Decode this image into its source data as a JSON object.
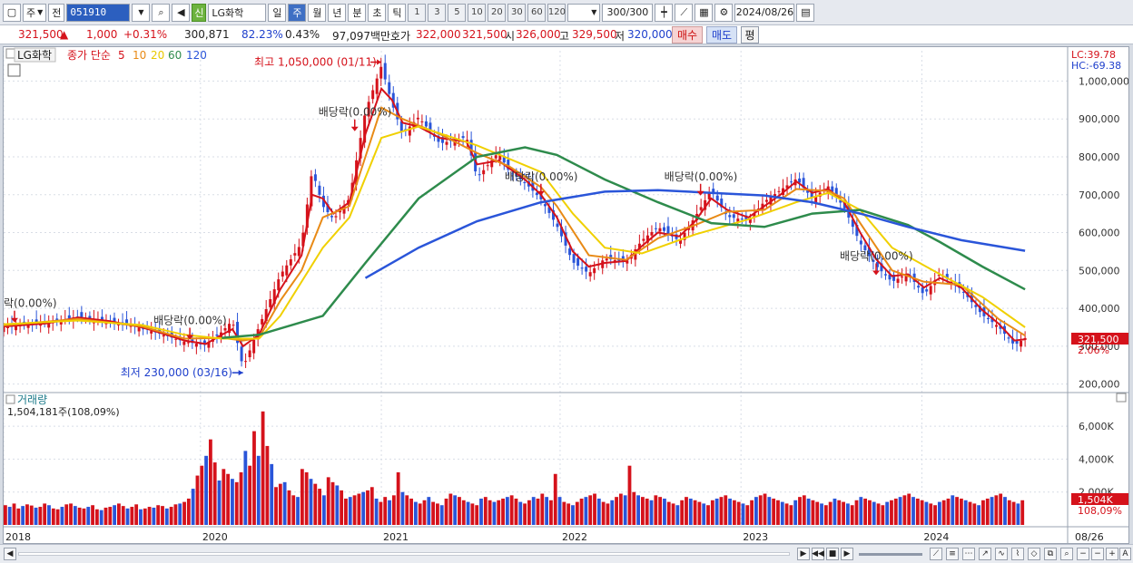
{
  "toolbar": {
    "period_selector": "주",
    "prev_label": "전",
    "stock_code": "051910",
    "new_badge": "신",
    "stock_name": "LG화학",
    "periods": [
      "일",
      "주",
      "월",
      "년",
      "분",
      "초",
      "틱"
    ],
    "active_period": "주",
    "intervals": [
      "1",
      "3",
      "5",
      "10",
      "20",
      "30",
      "60",
      "120"
    ],
    "count": "300",
    "count_total": "/300",
    "date": "2024/08/26"
  },
  "quote": {
    "price": "321,500",
    "change": "1,000",
    "change_pct": "+0.31%",
    "volume": "300,871",
    "ratio1": "82.23%",
    "ratio2": "0.43%",
    "amount": "97,097백만",
    "ask_label": "호가",
    "ask1": "322,000",
    "ask2": "321,500",
    "open_label": "시",
    "open": "326,000",
    "high_label": "고",
    "high": "329,500",
    "low_label": "저",
    "low": "320,000",
    "buy": "매수",
    "sell": "매도",
    "eval": "평"
  },
  "chart_data": {
    "type": "line",
    "title": "LG화학",
    "legend": {
      "ma_label": "종가 단순",
      "ma_periods": [
        "5",
        "10",
        "20",
        "60",
        "120"
      ],
      "ma_colors": [
        "#d5121b",
        "#e88a16",
        "#f0d000",
        "#2e8b4c",
        "#2a55d9"
      ]
    },
    "ylim": [
      180000,
      1080000
    ],
    "y_ticks": [
      "1,000,000",
      "900,000",
      "800,000",
      "700,000",
      "600,000",
      "500,000",
      "400,000",
      "300,000",
      "200,000"
    ],
    "x_labels": [
      "2018",
      "2020",
      "2021",
      "2022",
      "2023",
      "2024",
      "08/26"
    ],
    "lc": "LC:39.78",
    "hc": "HC:-69.38",
    "current_price": "321,500",
    "current_pct": "2.06%",
    "series": [
      {
        "name": "종가",
        "points": [
          [
            0,
            350000
          ],
          [
            0.04,
            362000
          ],
          [
            0.07,
            378000
          ],
          [
            0.1,
            365000
          ],
          [
            0.13,
            348000
          ],
          [
            0.15,
            330000
          ],
          [
            0.17,
            312000
          ],
          [
            0.19,
            303000
          ],
          [
            0.205,
            338000
          ],
          [
            0.215,
            368000
          ],
          [
            0.225,
            243000
          ],
          [
            0.24,
            352000
          ],
          [
            0.26,
            488000
          ],
          [
            0.28,
            572000
          ],
          [
            0.29,
            765000
          ],
          [
            0.3,
            670000
          ],
          [
            0.31,
            635000
          ],
          [
            0.325,
            690000
          ],
          [
            0.34,
            920000
          ],
          [
            0.355,
            1040000
          ],
          [
            0.365,
            940000
          ],
          [
            0.375,
            860000
          ],
          [
            0.39,
            905000
          ],
          [
            0.41,
            835000
          ],
          [
            0.435,
            852000
          ],
          [
            0.445,
            744000
          ],
          [
            0.465,
            812000
          ],
          [
            0.475,
            762000
          ],
          [
            0.49,
            732000
          ],
          [
            0.505,
            688000
          ],
          [
            0.52,
            618000
          ],
          [
            0.535,
            522000
          ],
          [
            0.55,
            492000
          ],
          [
            0.565,
            532000
          ],
          [
            0.585,
            522000
          ],
          [
            0.6,
            580000
          ],
          [
            0.615,
            615000
          ],
          [
            0.635,
            578000
          ],
          [
            0.65,
            642000
          ],
          [
            0.665,
            712000
          ],
          [
            0.68,
            642000
          ],
          [
            0.7,
            632000
          ],
          [
            0.715,
            682000
          ],
          [
            0.73,
            712000
          ],
          [
            0.745,
            742000
          ],
          [
            0.76,
            690000
          ],
          [
            0.775,
            722000
          ],
          [
            0.79,
            666000
          ],
          [
            0.805,
            572000
          ],
          [
            0.82,
            512000
          ],
          [
            0.835,
            470000
          ],
          [
            0.85,
            492000
          ],
          [
            0.865,
            435000
          ],
          [
            0.88,
            492000
          ],
          [
            0.9,
            450000
          ],
          [
            0.92,
            382000
          ],
          [
            0.935,
            352000
          ],
          [
            0.95,
            302000
          ],
          [
            0.96,
            321500
          ]
        ]
      },
      {
        "name": "5",
        "points": [
          [
            0,
            352000
          ],
          [
            0.04,
            360000
          ],
          [
            0.07,
            376000
          ],
          [
            0.1,
            366000
          ],
          [
            0.13,
            350000
          ],
          [
            0.15,
            333000
          ],
          [
            0.17,
            315000
          ],
          [
            0.19,
            306000
          ],
          [
            0.205,
            330000
          ],
          [
            0.215,
            345000
          ],
          [
            0.225,
            300000
          ],
          [
            0.24,
            330000
          ],
          [
            0.26,
            450000
          ],
          [
            0.28,
            540000
          ],
          [
            0.29,
            700000
          ],
          [
            0.3,
            690000
          ],
          [
            0.31,
            650000
          ],
          [
            0.325,
            680000
          ],
          [
            0.34,
            860000
          ],
          [
            0.355,
            980000
          ],
          [
            0.365,
            950000
          ],
          [
            0.375,
            890000
          ],
          [
            0.39,
            880000
          ],
          [
            0.41,
            850000
          ],
          [
            0.435,
            840000
          ],
          [
            0.445,
            780000
          ],
          [
            0.465,
            790000
          ],
          [
            0.475,
            770000
          ],
          [
            0.49,
            740000
          ],
          [
            0.505,
            700000
          ],
          [
            0.52,
            640000
          ],
          [
            0.535,
            550000
          ],
          [
            0.55,
            510000
          ],
          [
            0.565,
            520000
          ],
          [
            0.585,
            525000
          ],
          [
            0.6,
            565000
          ],
          [
            0.615,
            600000
          ],
          [
            0.635,
            590000
          ],
          [
            0.65,
            630000
          ],
          [
            0.665,
            690000
          ],
          [
            0.68,
            660000
          ],
          [
            0.7,
            640000
          ],
          [
            0.715,
            670000
          ],
          [
            0.73,
            700000
          ],
          [
            0.745,
            735000
          ],
          [
            0.76,
            705000
          ],
          [
            0.775,
            715000
          ],
          [
            0.79,
            680000
          ],
          [
            0.805,
            600000
          ],
          [
            0.82,
            530000
          ],
          [
            0.835,
            485000
          ],
          [
            0.85,
            490000
          ],
          [
            0.865,
            455000
          ],
          [
            0.88,
            480000
          ],
          [
            0.9,
            455000
          ],
          [
            0.92,
            395000
          ],
          [
            0.935,
            360000
          ],
          [
            0.95,
            315000
          ],
          [
            0.96,
            318000
          ]
        ]
      },
      {
        "name": "10",
        "points": [
          [
            0,
            355000
          ],
          [
            0.07,
            372000
          ],
          [
            0.13,
            352000
          ],
          [
            0.17,
            320000
          ],
          [
            0.205,
            322000
          ],
          [
            0.225,
            315000
          ],
          [
            0.24,
            322000
          ],
          [
            0.26,
            420000
          ],
          [
            0.28,
            500000
          ],
          [
            0.3,
            640000
          ],
          [
            0.325,
            670000
          ],
          [
            0.34,
            800000
          ],
          [
            0.355,
            930000
          ],
          [
            0.375,
            900000
          ],
          [
            0.41,
            860000
          ],
          [
            0.445,
            810000
          ],
          [
            0.475,
            775000
          ],
          [
            0.505,
            720000
          ],
          [
            0.52,
            670000
          ],
          [
            0.55,
            540000
          ],
          [
            0.585,
            528000
          ],
          [
            0.615,
            585000
          ],
          [
            0.65,
            620000
          ],
          [
            0.68,
            655000
          ],
          [
            0.715,
            660000
          ],
          [
            0.745,
            715000
          ],
          [
            0.775,
            710000
          ],
          [
            0.79,
            690000
          ],
          [
            0.805,
            625000
          ],
          [
            0.835,
            500000
          ],
          [
            0.865,
            470000
          ],
          [
            0.9,
            462000
          ],
          [
            0.935,
            372000
          ],
          [
            0.96,
            328000
          ]
        ]
      },
      {
        "name": "20",
        "points": [
          [
            0,
            358000
          ],
          [
            0.07,
            368000
          ],
          [
            0.13,
            356000
          ],
          [
            0.17,
            330000
          ],
          [
            0.205,
            320000
          ],
          [
            0.24,
            320000
          ],
          [
            0.26,
            380000
          ],
          [
            0.3,
            560000
          ],
          [
            0.325,
            640000
          ],
          [
            0.355,
            850000
          ],
          [
            0.39,
            880000
          ],
          [
            0.445,
            830000
          ],
          [
            0.505,
            760000
          ],
          [
            0.535,
            650000
          ],
          [
            0.565,
            560000
          ],
          [
            0.6,
            545000
          ],
          [
            0.65,
            595000
          ],
          [
            0.7,
            635000
          ],
          [
            0.745,
            680000
          ],
          [
            0.775,
            705000
          ],
          [
            0.805,
            660000
          ],
          [
            0.835,
            560000
          ],
          [
            0.88,
            490000
          ],
          [
            0.92,
            430000
          ],
          [
            0.96,
            350000
          ]
        ]
      },
      {
        "name": "60",
        "points": [
          [
            0.205,
            322000
          ],
          [
            0.24,
            330000
          ],
          [
            0.3,
            380000
          ],
          [
            0.34,
            520000
          ],
          [
            0.39,
            690000
          ],
          [
            0.445,
            800000
          ],
          [
            0.49,
            825000
          ],
          [
            0.52,
            805000
          ],
          [
            0.565,
            740000
          ],
          [
            0.615,
            680000
          ],
          [
            0.665,
            625000
          ],
          [
            0.715,
            615000
          ],
          [
            0.76,
            650000
          ],
          [
            0.805,
            660000
          ],
          [
            0.85,
            620000
          ],
          [
            0.88,
            575000
          ],
          [
            0.92,
            510000
          ],
          [
            0.96,
            450000
          ]
        ]
      },
      {
        "name": "120",
        "points": [
          [
            0.34,
            480000
          ],
          [
            0.39,
            560000
          ],
          [
            0.445,
            630000
          ],
          [
            0.505,
            680000
          ],
          [
            0.565,
            708000
          ],
          [
            0.615,
            712000
          ],
          [
            0.665,
            705000
          ],
          [
            0.715,
            698000
          ],
          [
            0.76,
            680000
          ],
          [
            0.805,
            650000
          ],
          [
            0.85,
            615000
          ],
          [
            0.9,
            580000
          ],
          [
            0.96,
            552000
          ]
        ]
      }
    ],
    "annotations": [
      {
        "text": "최고 1,050,000 (01/11)",
        "x": 0.355,
        "y": 1050000
      },
      {
        "text": "최저 230,000 (03/16)",
        "x": 0.225,
        "y": 230000
      },
      {
        "text": "락(0.00%)",
        "x": 0.0,
        "y": 365000
      },
      {
        "text": "배당락(0.00%)",
        "x": 0.175,
        "y": 320000
      },
      {
        "text": "배당락(0.00%)",
        "x": 0.33,
        "y": 870000
      },
      {
        "text": "배당락(0.00%)",
        "x": 0.505,
        "y": 700000
      },
      {
        "text": "배당락(0.00%)",
        "x": 0.655,
        "y": 700000
      },
      {
        "text": "배당락(0.00%)",
        "x": 0.82,
        "y": 490000
      }
    ],
    "volume": {
      "title": "거래량",
      "value_label": "1,504,181주(108,09%)",
      "y_ticks": [
        "6,000K",
        "4,000K",
        "2,000K"
      ],
      "current": "1,504K",
      "current_pct": "108,09%",
      "ylim": [
        0,
        7000
      ],
      "values": [
        1200,
        1100,
        1300,
        1000,
        1150,
        1250,
        1180,
        1050,
        1100,
        1300,
        1200,
        1000,
        950,
        1100,
        1250,
        1300,
        1150,
        1050,
        1000,
        1100,
        1200,
        950,
        900,
        1050,
        1100,
        1200,
        1300,
        1150,
        1000,
        1100,
        1250,
        950,
        1000,
        1100,
        1050,
        1200,
        1150,
        1000,
        1100,
        1250,
        1300,
        1400,
        1600,
        2200,
        3000,
        3600,
        4200,
        5200,
        3800,
        2700,
        3400,
        3100,
        2800,
        2600,
        3200,
        4500,
        3600,
        5700,
        4200,
        6900,
        4800,
        3700,
        2300,
        2500,
        2600,
        2100,
        1800,
        1700,
        3400,
        3200,
        2800,
        2500,
        2200,
        1800,
        2900,
        2600,
        2400,
        2100,
        1600,
        1700,
        1800,
        1900,
        2000,
        2100,
        2300,
        1600,
        1400,
        1700,
        1500,
        1800,
        3200,
        2000,
        1800,
        1600,
        1400,
        1300,
        1500,
        1700,
        1400,
        1300,
        1200,
        1600,
        1900,
        1800,
        1700,
        1500,
        1400,
        1300,
        1200,
        1600,
        1700,
        1500,
        1400,
        1500,
        1600,
        1700,
        1800,
        1600,
        1400,
        1300,
        1500,
        1700,
        1600,
        1900,
        1700,
        1500,
        3100,
        1700,
        1400,
        1300,
        1200,
        1400,
        1600,
        1700,
        1800,
        1900,
        1600,
        1400,
        1300,
        1500,
        1700,
        1900,
        1800,
        3600,
        2000,
        1800,
        1700,
        1600,
        1500,
        1800,
        1700,
        1600,
        1400,
        1300,
        1200,
        1500,
        1700,
        1600,
        1500,
        1400,
        1300,
        1200,
        1500,
        1600,
        1700,
        1800,
        1600,
        1500,
        1400,
        1300,
        1200,
        1500,
        1700,
        1800,
        1900,
        1700,
        1600,
        1500,
        1400,
        1300,
        1200,
        1500,
        1700,
        1800,
        1600,
        1500,
        1400,
        1300,
        1200,
        1400,
        1600,
        1500,
        1400,
        1300,
        1200,
        1500,
        1700,
        1600,
        1500,
        1400,
        1300,
        1200,
        1400,
        1500,
        1600,
        1700,
        1800,
        1900,
        1700,
        1600,
        1500,
        1400,
        1300,
        1200,
        1400,
        1500,
        1600,
        1800,
        1700,
        1600,
        1500,
        1400,
        1300,
        1200,
        1500,
        1600,
        1700,
        1800,
        1900,
        1700,
        1500,
        1400,
        1300,
        1500
      ]
    }
  }
}
